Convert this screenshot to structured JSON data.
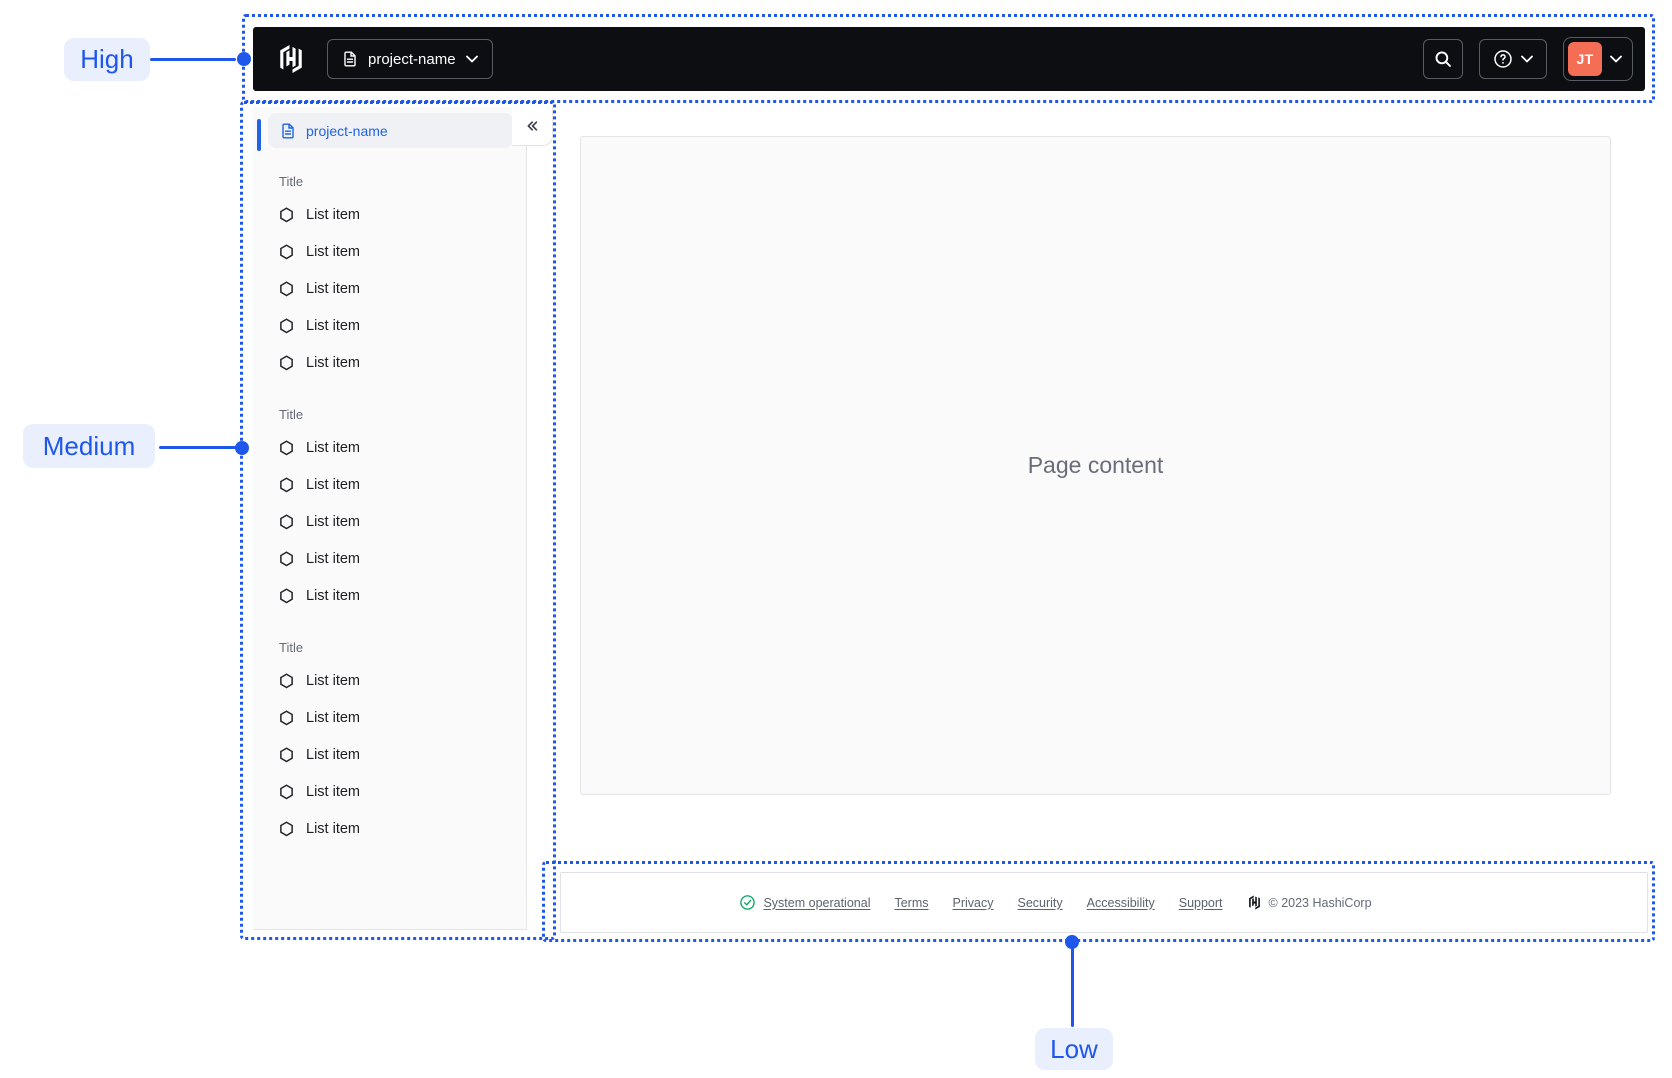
{
  "colors": {
    "annotation_accent": "#1f57eb",
    "annotation_pill_bg": "#e9effd",
    "navbar_bg": "#0c0e12",
    "sidebar_link_blue": "#2063e4",
    "avatar_bg": "#f46e56",
    "status_green": "#00a35c"
  },
  "annotations": {
    "high_label": "High",
    "medium_label": "Medium",
    "low_label": "Low"
  },
  "navbar": {
    "logo": "hashicorp-logo",
    "project_switcher_label": "project-name",
    "search_icon": "search-icon",
    "help_icon": "help-circle-icon",
    "user_initials": "JT"
  },
  "sidebar": {
    "active_item_label": "project-name",
    "collapse_icon": "chevrons-left-icon",
    "sections": [
      {
        "title": "Title",
        "items": [
          "List item",
          "List item",
          "List item",
          "List item",
          "List item"
        ]
      },
      {
        "title": "Title",
        "items": [
          "List item",
          "List item",
          "List item",
          "List item",
          "List item"
        ]
      },
      {
        "title": "Title",
        "items": [
          "List item",
          "List item",
          "List item",
          "List item",
          "List item"
        ]
      }
    ]
  },
  "main": {
    "placeholder": "Page content"
  },
  "footer": {
    "status_label": "System operational",
    "links": [
      "Terms",
      "Privacy",
      "Security",
      "Accessibility",
      "Support"
    ],
    "copyright": "© 2023 HashiCorp"
  }
}
